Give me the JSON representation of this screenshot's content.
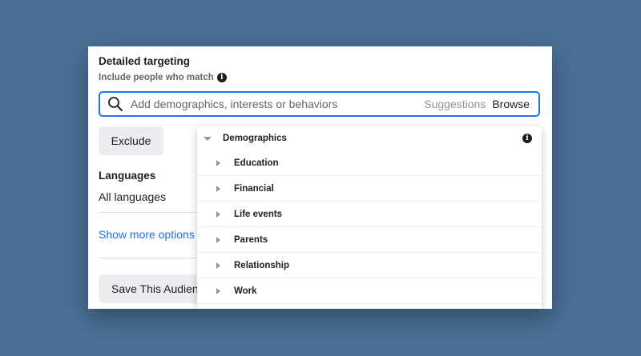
{
  "section": {
    "title": "Detailed targeting",
    "subtitle": "Include people who match"
  },
  "search": {
    "placeholder": "Add demographics, interests or behaviors",
    "suggestions_label": "Suggestions",
    "browse_label": "Browse"
  },
  "exclude_label": "Exclude",
  "languages": {
    "title": "Languages",
    "value": "All languages"
  },
  "show_more_label": "Show more options",
  "save_label": "Save This Audience",
  "dropdown": {
    "header": "Demographics",
    "items": [
      {
        "label": "Education"
      },
      {
        "label": "Financial"
      },
      {
        "label": "Life events"
      },
      {
        "label": "Parents"
      },
      {
        "label": "Relationship"
      },
      {
        "label": "Work"
      }
    ]
  },
  "colors": {
    "background": "#4a7096",
    "accent": "#1877f2",
    "link": "#216fdb"
  },
  "icons": {
    "info": "i"
  }
}
